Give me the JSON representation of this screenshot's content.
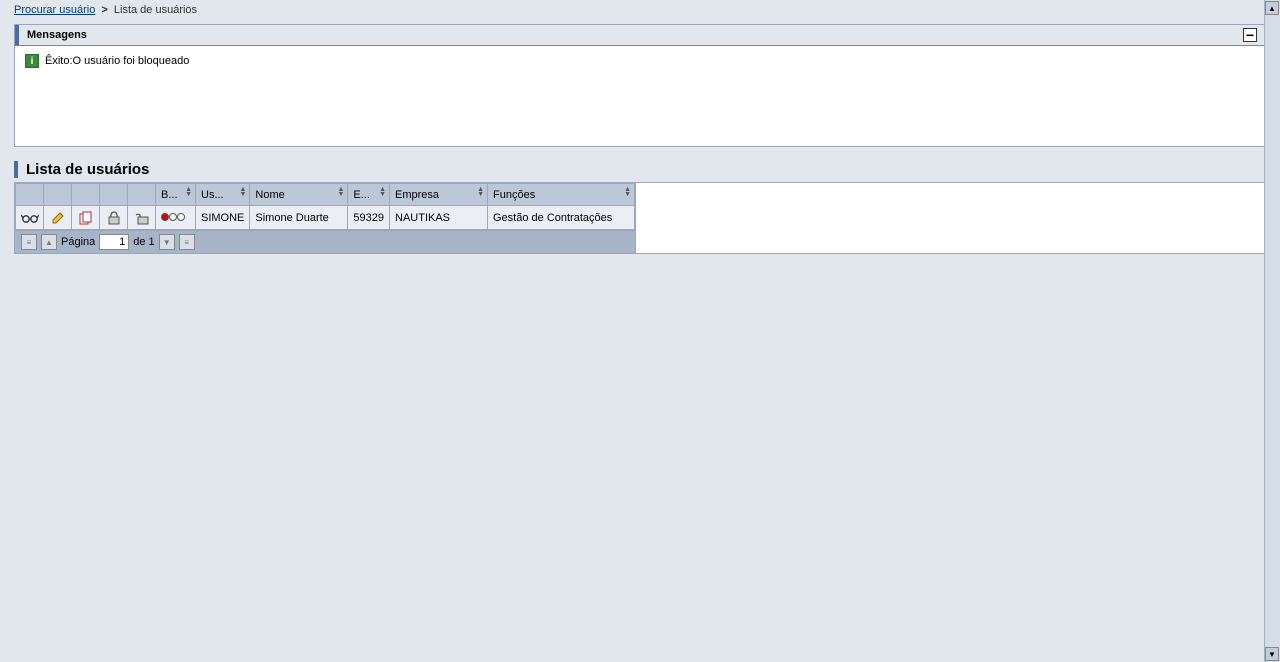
{
  "breadcrumb": {
    "link": "Procurar usuário",
    "current": "Lista de usuários"
  },
  "messages": {
    "title": "Mensagens",
    "items": [
      {
        "type": "success",
        "text": "Êxito:O usuário foi bloqueado"
      }
    ]
  },
  "list": {
    "title": "Lista de usuários",
    "columns": {
      "b": "B...",
      "us": "Us...",
      "nome": "Nome",
      "e": "E...",
      "empresa": "Empresa",
      "funcoes": "Funções"
    },
    "rows": [
      {
        "status": "blocked",
        "us": "SIMONE",
        "nome": "Simone Duarte",
        "e": "59329",
        "empresa": "NAUTIKAS",
        "funcoes": "Gestão de Contratações"
      }
    ],
    "pager": {
      "label_page": "Página",
      "current": "1",
      "of_text": "de 1"
    }
  }
}
